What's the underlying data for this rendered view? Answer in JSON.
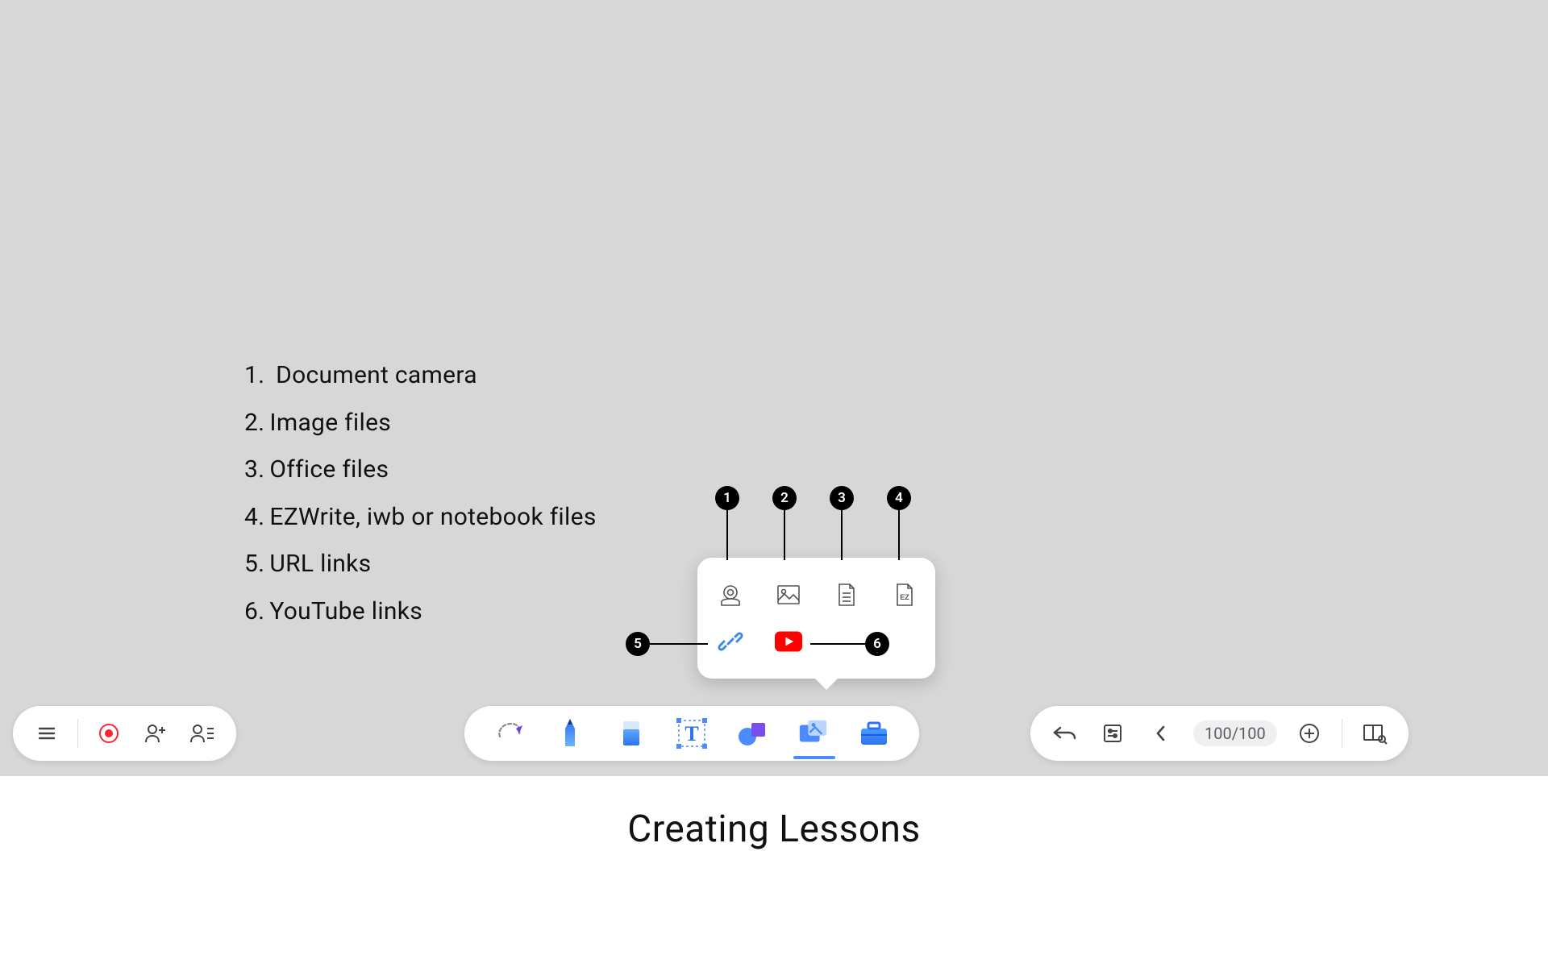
{
  "caption": "Creating Lessons",
  "legend": [
    {
      "index": "1.",
      "label": "Document camera"
    },
    {
      "index": "2.",
      "label": "Image files"
    },
    {
      "index": "3.",
      "label": "Office files"
    },
    {
      "index": "4.",
      "label": "EZWrite, iwb or notebook files"
    },
    {
      "index": "5.",
      "label": "URL links"
    },
    {
      "index": "6.",
      "label": "YouTube links"
    }
  ],
  "popup": {
    "ez_label": "EZ",
    "badges": {
      "1": "1",
      "2": "2",
      "3": "3",
      "4": "4",
      "5": "5",
      "6": "6"
    }
  },
  "pager": {
    "text": "100/100"
  }
}
